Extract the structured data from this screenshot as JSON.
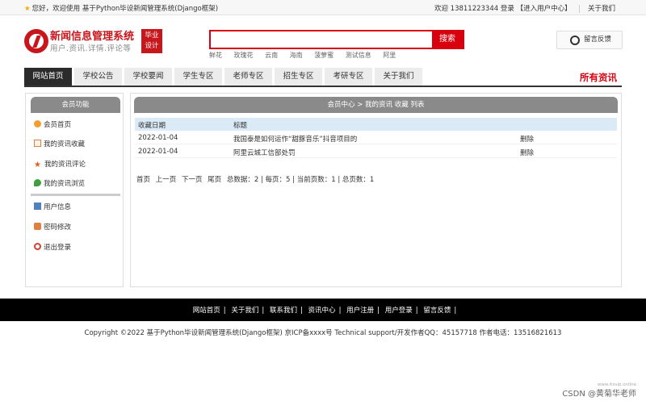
{
  "topbar": {
    "welcome": "您好，欢迎使用 基于Python毕设新闻管理系统(Django框架)",
    "user_prefix": "欢迎 13811223344 登录",
    "enter_center": "【进入用户中心】",
    "about": "关于我们"
  },
  "logo": {
    "title": "新闻信息管理系统",
    "subtitle": "用户.资讯.详情.评论等",
    "badge_line1": "毕业",
    "badge_line2": "设计"
  },
  "search": {
    "placeholder": "",
    "button": "搜索",
    "hot": [
      "鲜花",
      "玫瑰花",
      "云南",
      "海南",
      "菠萝蜜",
      "测试信息",
      "阿里"
    ]
  },
  "feedback": {
    "label": "留言反馈",
    "icon": "headset-icon"
  },
  "nav": {
    "items": [
      "网站首页",
      "学校公告",
      "学校要闻",
      "学生专区",
      "老师专区",
      "招生专区",
      "考研专区",
      "关于我们"
    ],
    "active_index": 0,
    "all_news": "所有资讯"
  },
  "sidebar": {
    "title": "会员功能",
    "items": [
      {
        "label": "会员首页",
        "icon": "home-icon",
        "color": "#f0a030"
      },
      {
        "label": "我的资讯收藏",
        "icon": "bookmark-icon",
        "color": "#e08040"
      },
      {
        "label": "我的资讯评论",
        "icon": "star-icon",
        "color": "#e06020"
      },
      {
        "label": "我的资讯浏览",
        "icon": "map-pin-icon",
        "color": "#40a040"
      },
      {
        "label": "用户信息",
        "icon": "user-icon",
        "color": "#5080c0"
      },
      {
        "label": "密码修改",
        "icon": "lock-icon",
        "color": "#e08040"
      },
      {
        "label": "退出登录",
        "icon": "power-icon",
        "color": "#d04030"
      }
    ]
  },
  "content": {
    "breadcrumb": "会员中心 > 我的资讯 收藏 列表",
    "columns": [
      "收藏日期",
      "标题"
    ],
    "rows": [
      {
        "date": "2022-01-04",
        "title": "我国泰是如何运作“甜豚音乐”抖音项目的",
        "action": "删除"
      },
      {
        "date": "2022-01-04",
        "title": "阿里云城工信部处罚",
        "action": "删除"
      }
    ],
    "pager": {
      "first": "首页",
      "prev": "上一页",
      "next": "下一页",
      "last": "尾页",
      "summary": "总数据：2 | 每页：5 | 当前页数：1 | 总页数：1"
    }
  },
  "footer": {
    "links": [
      "网站首页",
      "关于我们",
      "联系我们",
      "资讯中心",
      "用户注册",
      "用户登录",
      "留言反馈"
    ],
    "copyright": "Copyright ©2022 基于Python毕设新闻管理系统(Django框架) 京ICP备xxxx号    Technical support/开发作者QQ：45157718    作者电话：13516821613"
  },
  "watermark": "CSDN @黄菊华老师",
  "watermark_small": "www.itsvip.online",
  "colors": {
    "brand_red": "#c8161d",
    "search_red": "#d9000e",
    "nav_active": "#2b2b2b",
    "header_gray": "#8a8a8a",
    "table_head": "#dbeaf7"
  }
}
